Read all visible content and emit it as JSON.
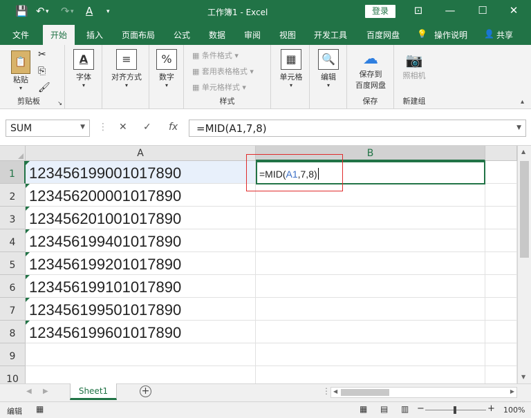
{
  "window": {
    "title": "工作簿1 - Excel",
    "login": "登录"
  },
  "tabs": [
    "文件",
    "开始",
    "插入",
    "页面布局",
    "公式",
    "数据",
    "审阅",
    "视图",
    "开发工具",
    "百度网盘",
    "操作说明",
    "共享"
  ],
  "ribbon": {
    "paste": "粘贴",
    "clipboard": "剪贴板",
    "font": "字体",
    "align": "对齐方式",
    "number": "数字",
    "cond_format": "条件格式",
    "table_format": "套用表格格式",
    "cell_style": "单元格样式",
    "styles": "样式",
    "cells": "单元格",
    "edit": "编辑",
    "save_to": "保存到",
    "baidu_disk": "百度网盘",
    "save": "保存",
    "camera": "照相机",
    "new_group": "新建组"
  },
  "formula_bar": {
    "name_box": "SUM",
    "formula": "=MID(A1,7,8)"
  },
  "columns": [
    "A",
    "B"
  ],
  "rows": [
    "1",
    "2",
    "3",
    "4",
    "5",
    "6",
    "7",
    "8",
    "9",
    "10"
  ],
  "cells_a": [
    "123456199001017890",
    "123456200001017890",
    "123456201001017890",
    "123456199401017890",
    "123456199201017890",
    "123456199101017890",
    "123456199501017890",
    "123456199601017890"
  ],
  "edit": {
    "prefix": "=MID(",
    "ref": "A1",
    "suffix": ",7,8)"
  },
  "sheet": {
    "name": "Sheet1"
  },
  "status": {
    "mode": "编辑",
    "zoom": "100%"
  },
  "colors": {
    "accent": "#217346",
    "highlight": "#e02b2b"
  }
}
